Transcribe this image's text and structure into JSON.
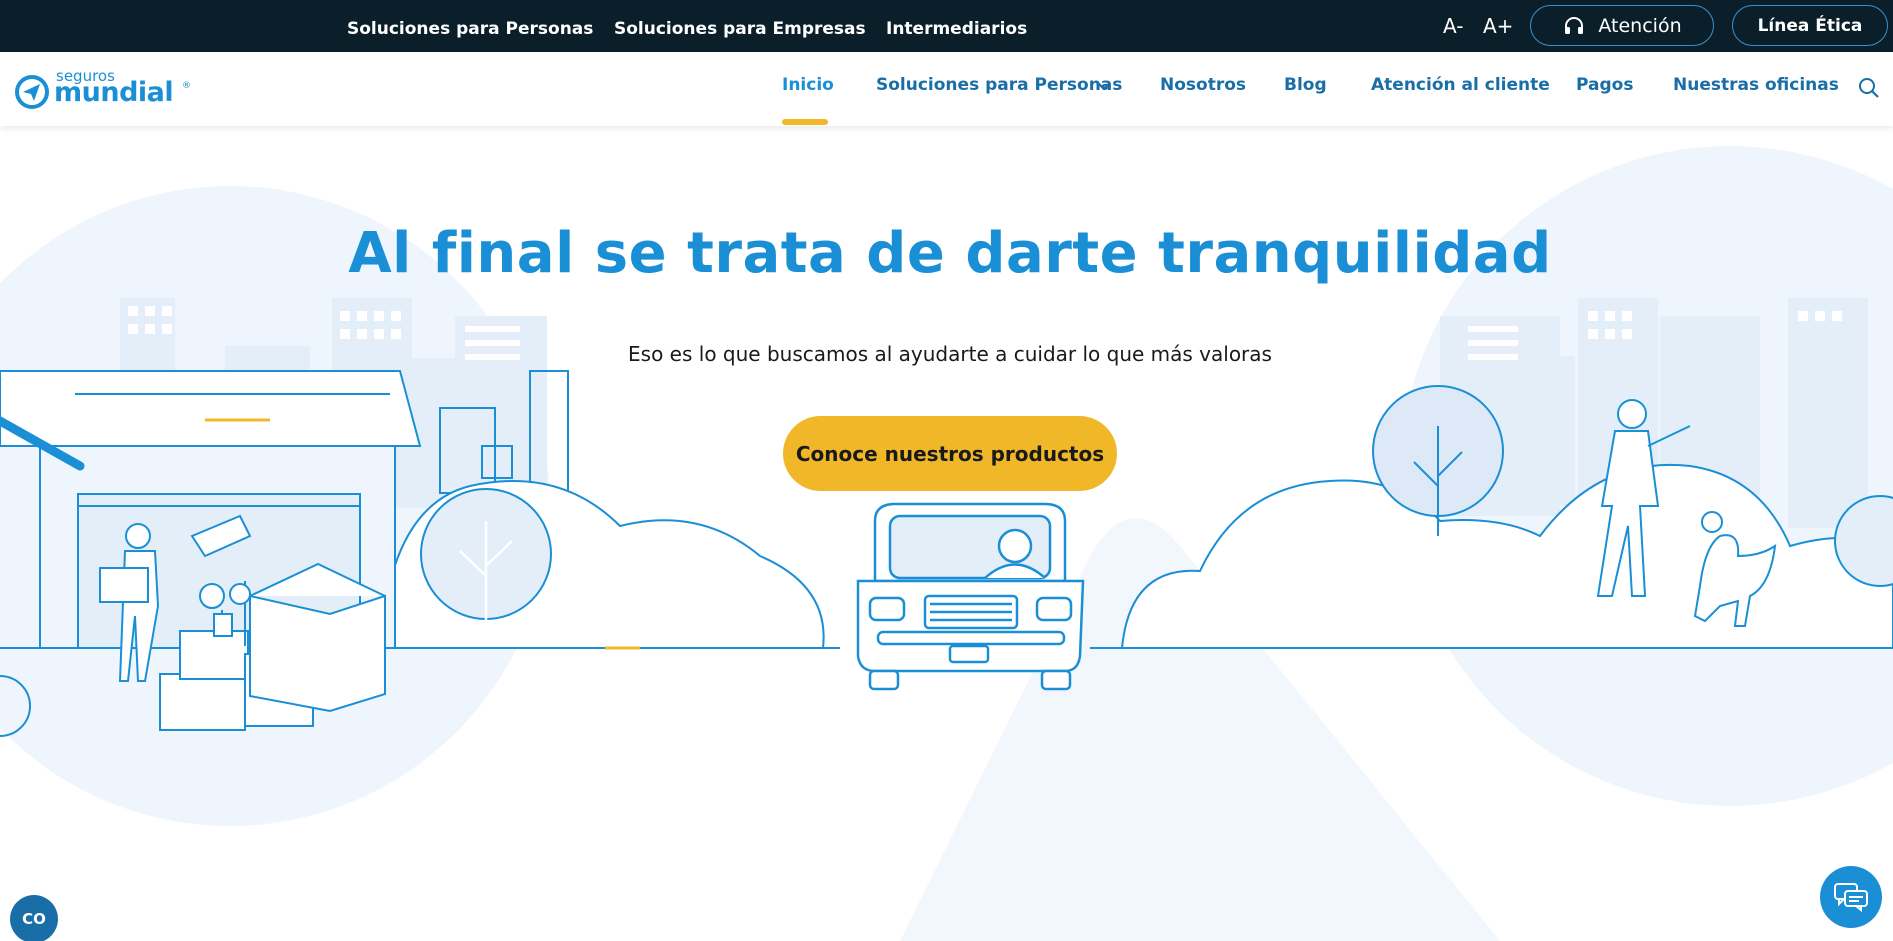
{
  "topbar": {
    "segments": [
      "Soluciones para Personas",
      "Soluciones para Empresas",
      "Intermediarios"
    ],
    "font_decrease": "A-",
    "font_increase": "A+",
    "attention_label": "Atención",
    "ethics_label": "Línea Ética"
  },
  "header": {
    "logo": {
      "small": "seguros",
      "big": "mundial",
      "mark": "®"
    },
    "nav": [
      "Inicio",
      "Soluciones para Personas",
      "Nosotros",
      "Blog",
      "Atención al cliente",
      "Pagos",
      "Nuestras oficinas"
    ],
    "active_nav": "Inicio"
  },
  "hero": {
    "title": "Al final se trata de darte tranquilidad",
    "subtitle": "Eso es lo que buscamos al ayudarte a cuidar lo que más valoras",
    "cta_label": "Conoce nuestros productos"
  },
  "widgets": {
    "cookie_label": "CO"
  },
  "colors": {
    "brand_blue": "#1a8fd6",
    "dark_navy": "#0b1f2a",
    "accent_yellow": "#f0b829",
    "illustration_light": "#e3eef9"
  },
  "icons": [
    "headset-icon",
    "chevron-down-icon",
    "search-icon",
    "chat-icon",
    "logo-icon"
  ]
}
